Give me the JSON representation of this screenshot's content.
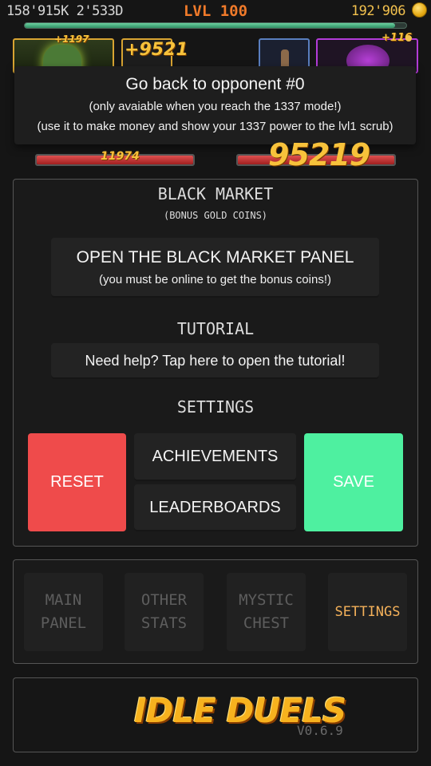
{
  "hud": {
    "stats_left": "158'915K 2'533D",
    "level": "LVL 100",
    "gold": "192'906",
    "xp_progress": 0.97
  },
  "arena": {
    "player_float": "+1197",
    "damage_float": "+9521",
    "opponent_float": "+116",
    "player_hp_text": "11974",
    "opponent_hp_text": "95219",
    "player_hp_fraction": 1.0,
    "opponent_hp_fraction": 1.0
  },
  "tooltip": {
    "title": "Go back to opponent #0",
    "line1": "(only avaiable when you reach the 1337 mode!)",
    "line2": "(use it to make money and show your 1337 power to the lvl1 scrub)"
  },
  "black_market": {
    "title": "BLACK MARKET",
    "subtitle": "(BONUS GOLD COINS)",
    "button_label": "OPEN THE BLACK MARKET PANEL",
    "button_sub": "(you must be online to get the bonus coins!)"
  },
  "tutorial": {
    "title": "TUTORIAL",
    "button_label": "Need help? Tap here to open the tutorial!"
  },
  "settings": {
    "title": "SETTINGS",
    "reset_label": "RESET",
    "achievements_label": "ACHIEVEMENTS",
    "leaderboards_label": "LEADERBOARDS",
    "save_label": "SAVE",
    "reset_color": "#ef4b4b",
    "save_color": "#4ef0a0"
  },
  "nav": {
    "main_panel": "MAIN\nPANEL",
    "other_stats": "OTHER\nSTATS",
    "mystic_chest": "MYSTIC\nCHEST",
    "settings": "SETTINGS",
    "active": "settings",
    "active_color": "#f4b15a"
  },
  "footer": {
    "logo": "IDLE DUELS",
    "version": "V0.6.9"
  },
  "icons": {
    "coin": "coin-icon",
    "gold_small": "coin-icon"
  }
}
